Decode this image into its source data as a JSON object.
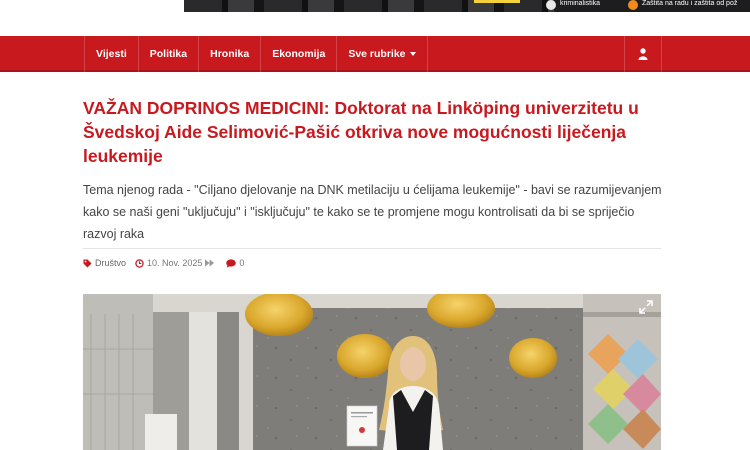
{
  "ad_banner": {
    "text_1": "kriminalistika",
    "text_2": "Zaštita na radu i zaštita od pož"
  },
  "navbar": {
    "items": [
      {
        "label": "Vijesti"
      },
      {
        "label": "Politika"
      },
      {
        "label": "Hronika"
      },
      {
        "label": "Ekonomija"
      },
      {
        "label": "Sve rubrike"
      }
    ],
    "user_icon": "user-icon",
    "color": "#c8191f"
  },
  "article": {
    "title": "VAŽAN DOPRINOS MEDICINI: Doktorat na Linköping univerzitetu u Švedskoj Aide Selimović-Pašić otkriva nove mogućnosti liječenja leukemije",
    "lead": "Tema njenog rada - \"Ciljano djelovanje na DNK metilaciju u ćelijama leukemije\" - bavi se razumijevanjem kako se naši geni \"uključuju\" i \"isključuju\" te kako se te promjene mogu kontrolisati da bi se spriječio razvoj raka",
    "meta": {
      "category": "Društvo",
      "date": "10. Nov. 2025",
      "comments": "0"
    },
    "image_icon": "expand-icon"
  },
  "colors": {
    "accent": "#c8191f",
    "title": "#c8191f",
    "text": "#444444"
  }
}
